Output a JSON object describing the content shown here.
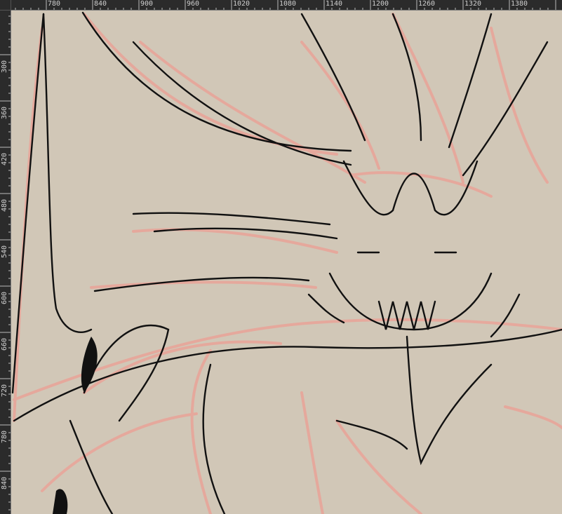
{
  "ruler_horizontal": {
    "labels": [
      "780",
      "840",
      "900",
      "960",
      "1020",
      "1080",
      "1140",
      "1200",
      "1260",
      "1320",
      "1380"
    ]
  },
  "ruler_vertical": {
    "labels": [
      "300",
      "360",
      "420",
      "480",
      "540",
      "600",
      "660",
      "720",
      "780",
      "840"
    ]
  },
  "canvas": {
    "background": "#d1c7b7",
    "sketch_color": "#e8a59a",
    "ink_color": "#111111"
  }
}
